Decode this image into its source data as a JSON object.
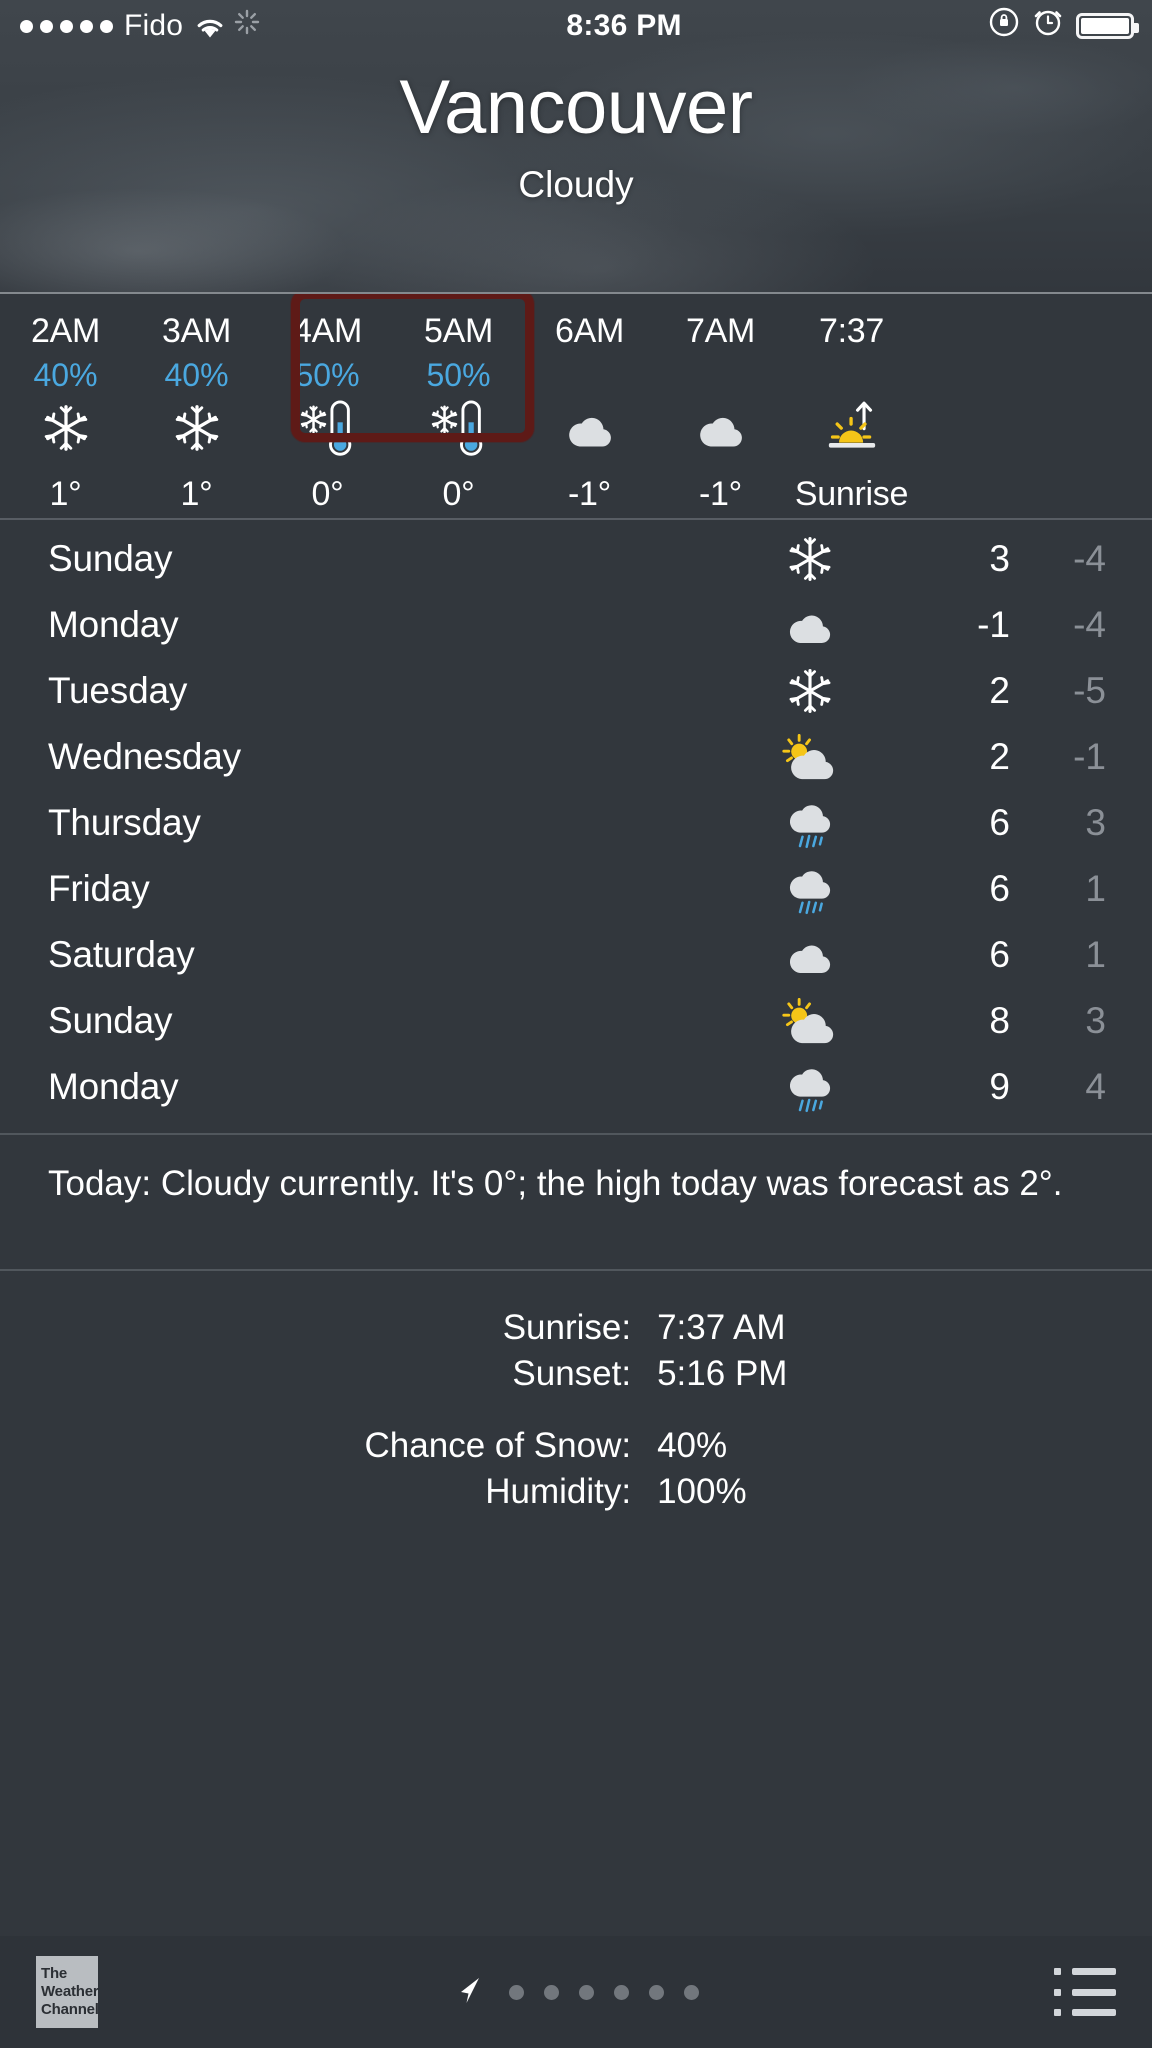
{
  "statusbar": {
    "signal_dots": 5,
    "carrier": "Fido",
    "wifi_icon": "wifi-icon",
    "activity_icon": "activity-spinner-icon",
    "time": "8:36 PM",
    "rotation_lock_icon": "rotation-lock-icon",
    "alarm_icon": "alarm-clock-icon",
    "battery_icon": "battery-full-icon"
  },
  "header": {
    "city": "Vancouver",
    "condition": "Cloudy"
  },
  "hourly": {
    "columns": [
      {
        "time": "2AM",
        "pop": "40%",
        "icon": "snow-icon",
        "temp": "1°"
      },
      {
        "time": "3AM",
        "pop": "40%",
        "icon": "snow-icon",
        "temp": "1°"
      },
      {
        "time": "4AM",
        "pop": "50%",
        "icon": "freezing-rain-icon",
        "temp": "0°"
      },
      {
        "time": "5AM",
        "pop": "50%",
        "icon": "freezing-rain-icon",
        "temp": "0°"
      },
      {
        "time": "6AM",
        "pop": "",
        "icon": "cloudy-icon",
        "temp": "-1°"
      },
      {
        "time": "7AM",
        "pop": "",
        "icon": "cloudy-icon",
        "temp": "-1°"
      },
      {
        "time": "7:37",
        "pop": "",
        "icon": "sunrise-icon",
        "temp": "Sunrise"
      }
    ],
    "annotation": {
      "color": "#5e1a17",
      "covers": [
        "4AM",
        "5AM"
      ]
    }
  },
  "daily": {
    "rows": [
      {
        "day": "Sunday",
        "icon": "snow-icon",
        "high": "3",
        "low": "-4"
      },
      {
        "day": "Monday",
        "icon": "cloudy-icon",
        "high": "-1",
        "low": "-4"
      },
      {
        "day": "Tuesday",
        "icon": "snow-icon",
        "high": "2",
        "low": "-5"
      },
      {
        "day": "Wednesday",
        "icon": "partly-sunny-icon",
        "high": "2",
        "low": "-1"
      },
      {
        "day": "Thursday",
        "icon": "rain-icon",
        "high": "6",
        "low": "3"
      },
      {
        "day": "Friday",
        "icon": "rain-icon",
        "high": "6",
        "low": "1"
      },
      {
        "day": "Saturday",
        "icon": "cloudy-icon",
        "high": "6",
        "low": "1"
      },
      {
        "day": "Sunday",
        "icon": "partly-sunny-icon",
        "high": "8",
        "low": "3"
      },
      {
        "day": "Monday",
        "icon": "rain-icon",
        "high": "9",
        "low": "4"
      }
    ]
  },
  "summary": {
    "text": "Today: Cloudy currently. It's 0°; the high today was forecast as 2°."
  },
  "details": {
    "sunrise_label": "Sunrise:",
    "sunrise_value": "7:37 AM",
    "sunset_label": "Sunset:",
    "sunset_value": "5:16 PM",
    "snow_label": "Chance of Snow:",
    "snow_value": "40%",
    "humidity_label": "Humidity:",
    "humidity_value": "100%"
  },
  "tabbar": {
    "logo_line1": "The",
    "logo_line2": "Weather",
    "logo_line3": "Channel",
    "location_icon": "location-arrow-icon",
    "page_dots": 6,
    "list_icon": "list-icon"
  },
  "colors": {
    "background": "#32373d",
    "pop_blue": "#4aa8e0",
    "low_temp_gray": "#8b9097",
    "annotation_red": "#5e1a17",
    "sun_yellow": "#f5c518"
  }
}
